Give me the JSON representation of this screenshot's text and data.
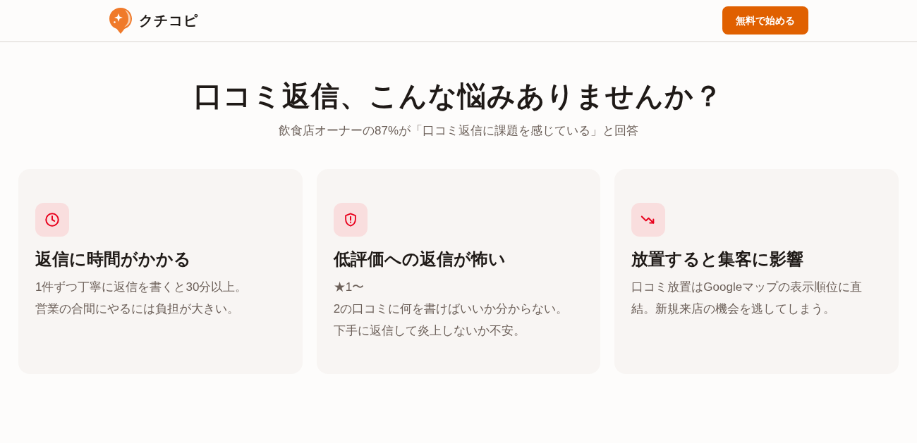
{
  "header": {
    "logo": {
      "text": "クチコピ"
    },
    "cta_button": {
      "label": "無料で始める"
    }
  },
  "section": {
    "title": "口コミ返信、こんな悩みありませんか？",
    "subtitle": "飲食店オーナーの87%が「口コミ返信に課題を感じている」と回答"
  },
  "cards": [
    {
      "kind": "clock",
      "title": "返信に時間がかかる",
      "description": [
        "1件ずつ丁寧に返信を書くと30分以上。",
        "営業の合間にやるには負担が大きい。"
      ]
    },
    {
      "kind": "shield",
      "title": "低評価への返信が怖い",
      "description": [
        "★1〜",
        "2の口コミに何を書けばいいか分からない。",
        "下手に返信して炎上しないか不安。"
      ]
    },
    {
      "kind": "trend-down",
      "title": "放置すると集客に影響",
      "description": [
        "口コミ放置はGoogleマップの表示順位に直",
        "結。新規来店の機会を逃してしまう。"
      ]
    }
  ]
}
